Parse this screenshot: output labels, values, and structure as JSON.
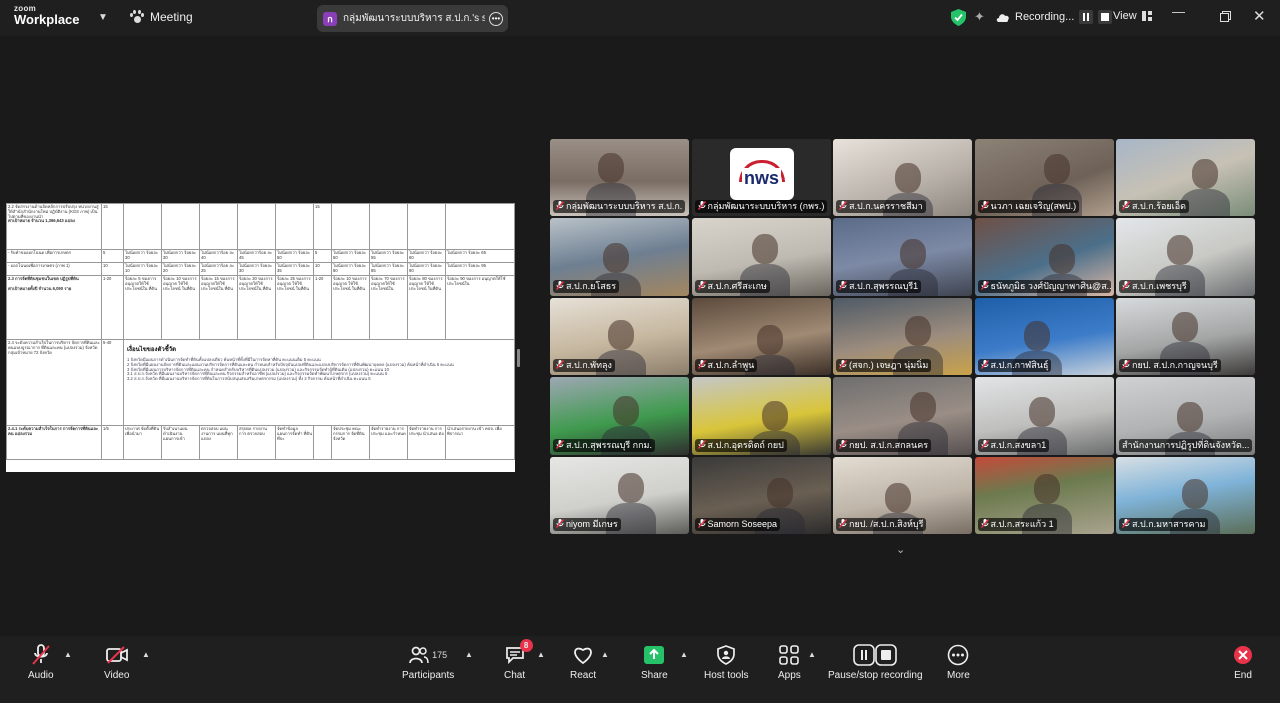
{
  "topbar": {
    "logo_line1": "zoom",
    "logo_line2": "Workplace",
    "meeting_label": "Meeting",
    "share_initial": "ก",
    "share_title": "กลุ่มพัฒนาระบบบริหาร ส.ป.ก.'s screen",
    "recording_label": "Recording...",
    "view_label": "View"
  },
  "document": {
    "rows": [
      {
        "no": "2.2 จัดสรรงานด้านจัดหลักการปรับปรุง หน่วยงานสู่ให้สำนักสำนักงานใหม่ ปฏิบัติงาน (KGS ภาพ) เป็นไปตามที่ของงานนำ",
        "sub": "ค่าเป้าหมาย จำนวน 1,366,643 แปลง",
        "w": "15",
        "val": "15"
      },
      {
        "no": "- รับคำขอออกโฉนด เพื่อการเกษตร",
        "w": "5",
        "cells": [
          "ไม่น้อยกว่า ร้อยละ 30",
          "ไม่น้อยกว่า ร้อยละ 30",
          "ไม่น้อยกว่าร้อย ละ 40",
          "ไม่น้อยกว่าร้อย ละ 45",
          "ไม่น้อยกว่า ร้อยละ 50",
          "5",
          "ไม่น้อยกว่า ร้อยละ 50",
          "ไม่น้อยกว่า ร้อยละ 55",
          "ไม่น้อยกว่า ร้อยละ 60",
          "ไม่น้อยกว่า ร้อยละ 65"
        ]
      },
      {
        "no": "- ออกโฉนดเพื่อการเกษตร (ภาพ 1)",
        "w": "10",
        "cells": [
          "ไม่น้อยกว่า ร้อยละ 10",
          "ไม่น้อยกว่า ร้อยละ 20",
          "ไม่น้อยกว่าร้อย ละ 25",
          "ไม่น้อยกว่า ร้อยละ 30",
          "ไม่น้อยกว่า ร้อยละ 35",
          "10",
          "ไม่น้อยกว่า ร้อยละ 80",
          "ไม่น้อยกว่า ร้อยละ 85",
          "ไม่น้อยกว่า ร้อยละ 90",
          "ไม่น้อยกว่า ร้อยละ 95"
        ]
      },
      {
        "no": "2.3 การจัดที่ดินชุมชนในเขต ปฏิรูปที่ดิน",
        "sub": "ค่าเป้าหมายทั้งปี จำนวน 6,090 ราย",
        "w": "1-20",
        "cells": [
          "ร้อยละ 5 ของการ อนุญาตให้ใช้ ประโยชน์ใน ที่ดิน",
          "ร้อยละ 10 ของการอนุญาต ให้ใช้ประโยชน์ ในที่ดิน",
          "ร้อยละ 15 ของการ อนุญาตให้ใช้ ประโยชน์ใน ที่ดิน",
          "ร้อยละ 20 ของการ อนุญาตให้ใช้ ประโยชน์ใน ที่ดิน",
          "ร้อยละ 25 ของการอนุญาต ให้ใช้ประโยชน์ ในที่ดิน",
          "1-20",
          "ร้อยละ 10 ของการอนุญาต ให้ใช้ประโยชน์ ในที่ดิน",
          "ร้อยละ 70 ของการ อนุญาตให้ใช้ ประโยชน์ใน",
          "ร้อยละ 80 ของการอนุญาต ให้ใช้ประโยชน์ ในที่ดิน",
          "ร้อยละ 90 ของการ อนุญาตให้ใช้ ประโยชน์ใน"
        ]
      },
      {
        "no": "2.4 ระดับความสำเร็จในการบริหาร จัดการที่ดินและคนแบบบูรณาการ ที่ดินและคน (แปลงรวม) จังหวัด กลุ่มเป้าหมาย 72 จังหวัด",
        "w": "5-40",
        "heading": "เงื่อนไขของตัวชี้วัด",
        "notes": [
          "1 จังหวัดมีแผนการดำเนินการจัดทำที่ดินทั้งแปลงเดียว ค้นหน้าที่ทั้งที่มีในการจัดหาที่ดิน คะแนนเต็ม 5 คะแนน",
          "2 จังหวัดที่มีแผนงานจัดการที่ดินและแผนงานบริหารจัดการที่ดินและคน กำหนดสำหรับปัจจุบันแปลงที่ดินและแปลงบริหารจัดการที่ดินพัฒนาบุคคล (แปลงรวม) ค้นหน้าที่ดำเนิน 5 คะแนน",
          "3 จังหวัดที่มีแผนการบริหารจัดการที่ดินและคน กำหนดสำหรับบริหารที่ดินแปลงรวม (แปลงรวม) และกิจกรรมจัดทำผู้ที่ดินเดิม (แปลงรวม) คะแนน 10",
          "3.1 ส.ป.ก.จังหวัด ที่มีแผนงานบริหารจัดการที่ดินและคน กิจกรรมสำหรับอาชีพ (แปลงรวม) และกิจกรรมจัดทำพัฒนาเกษตรกร (แปลงรวม) คะแนน 5",
          "3.2 ส.ป.ก.จังหวัด ที่มีแผนงานบริหารจัดการที่ดินในการสนับสนุนส่งเสริมเกษตรกรรม (แปลงรวม) ทั้ง 2 กิจกรรม ค้นหน้าที่ดำเนิน คะแนน 5"
        ]
      },
      {
        "no": "2.4.1 ระดับความสำเร็จในการ การจัดการที่ดินและคน แปลงรวม",
        "w": "1/5",
        "cells": [
          "ประกาศ จัดตั้งที่ดิน เพื่อนำมา",
          "รับสำเนาแผน ดำเนินงาน แผนการเข้า",
          "ตรวจสอบ แผนงานการ แผนที่ทุกแปลง",
          "สรุปผล รายงานการ ตรวจสอบ",
          "จัดทำข้อมูล แผนการจัดทำ ที่ดินที่จะ",
          "",
          "จัดประชุม คณะกรรมการ จัดที่ดินจังหวัด",
          "จัดทำรายงาน การประชุม และกำหนด",
          "จัดทำรายงาน การประชุม นำเสนอ ต่อ",
          "นำเสนอรายงาน เข้า คปจ. เพื่อพิจารณา"
        ]
      }
    ]
  },
  "participants": [
    {
      "name": "กลุ่มพัฒนาระบบบริหาร ส.ป.ก.",
      "active": true
    },
    {
      "name": "กลุ่มพัฒนาระบบบริหาร (กพร.)",
      "logo": "nws"
    },
    {
      "name": "ส.ป.ก.นครราชสีมา"
    },
    {
      "name": "นวภา เฉยเจริญ(สพป.)"
    },
    {
      "name": "ส.ป.ก.ร้อยเอ็ด"
    },
    {
      "name": "ส.ป.ก.ยโสธร"
    },
    {
      "name": "ส.ป.ก.ศรีสะเกษ"
    },
    {
      "name": "ส.ป.ก.สุพรรณบุรี1"
    },
    {
      "name": "ธนัทภูมิธ วงศ์ปัญญาพาศิน@ส..."
    },
    {
      "name": "ส.ป.ก.เพชรบุรี"
    },
    {
      "name": "ส.ป.ก.พัทลุง"
    },
    {
      "name": "ส.ป.ก.ลำพูน"
    },
    {
      "name": "(สจก.) เจษฎา นุ่มนิ่ม"
    },
    {
      "name": "ส.ป.ก.กาฬสินธุ์"
    },
    {
      "name": "กยป. ส.ป.ก.กาญจนบุรี"
    },
    {
      "name": "ส.ป.ก.สุพรรณบุรี กกม."
    },
    {
      "name": "ส.ป.ก.อุตรดิตถ์ กยป"
    },
    {
      "name": "กยป. ส.ป.ก.สกลนคร"
    },
    {
      "name": "ส.ป.ก.สงขลา1"
    },
    {
      "name": "สำนักงานการปฏิรูปที่ดินจังหวัด...",
      "no_mic": true
    },
    {
      "name": "niyom มีเกษร"
    },
    {
      "name": "Samorn Soseepa"
    },
    {
      "name": "กยป. /ส.ป.ก.สิงห์บุรี"
    },
    {
      "name": "ส.ป.ก.สระแก้ว 1"
    },
    {
      "name": "ส.ป.ก.มหาสารคาม"
    }
  ],
  "toolbar": {
    "audio": "Audio",
    "video": "Video",
    "participants": "Participants",
    "participants_count": "175",
    "chat": "Chat",
    "chat_badge": "8",
    "react": "React",
    "share": "Share",
    "host_tools": "Host tools",
    "apps": "Apps",
    "record": "Pause/stop recording",
    "more": "More",
    "end": "End"
  },
  "colors": {
    "active_speaker": "#3fd46b",
    "share_green": "#25c26a",
    "end_red": "#e8334a",
    "muted_red": "#e8334a",
    "share_badge": "#8a3fb8"
  }
}
